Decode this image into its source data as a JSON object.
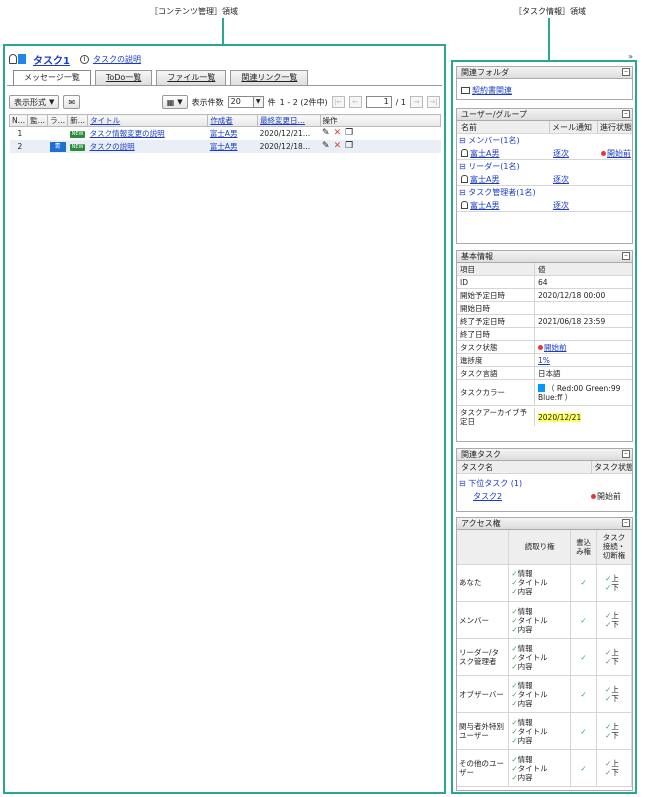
{
  "callouts": {
    "left": "［コンテンツ管理］領域",
    "right": "［タスク情報］領域"
  },
  "task": {
    "title": "タスク1",
    "link": "タスクの説明",
    "accent_color": "#1e88e5"
  },
  "tabs": [
    "メッセージ一覧",
    "ToDo一覧",
    "ファイル一覧",
    "関連リンク一覧"
  ],
  "toolbar": {
    "format_button": "表示形式",
    "count_label": "表示件数",
    "count_value": "20",
    "count_suffix": "件",
    "range": "1 - 2 (2件中)",
    "page_value": "1",
    "page_total": "/ 1"
  },
  "table": {
    "columns": [
      "N…",
      "監…",
      "ラ…",
      "新…",
      "タイトル",
      "作成者",
      "最終変更日…",
      "操作"
    ],
    "rows": [
      {
        "no": "1",
        "label": "",
        "new": "NEW",
        "title": "タスク情報変更の説明",
        "author": "富士A男",
        "modified": "2020/12/21…"
      },
      {
        "no": "2",
        "label": "青",
        "new": "NEW",
        "title": "タスクの説明",
        "author": "富士A男",
        "modified": "2020/12/18…"
      }
    ]
  },
  "right": {
    "collapse": "»",
    "related_folder": {
      "title": "関連フォルダ",
      "item": "契約書関連"
    },
    "users": {
      "title": "ユーザー/グループ",
      "headers": [
        "名前",
        "メール通知",
        "進行状態"
      ],
      "members_group": "メンバー(1名)",
      "members": [
        {
          "name": "富士A男",
          "mail": "逐次",
          "state": "開始前"
        }
      ],
      "leaders_group": "リーダー(1名)",
      "leaders": [
        {
          "name": "富士A男",
          "mail": "逐次"
        }
      ],
      "managers_group": "タスク管理者(1名)",
      "managers": [
        {
          "name": "富士A男",
          "mail": "逐次"
        }
      ]
    },
    "basic": {
      "title": "基本情報",
      "headers": [
        "項目",
        "値"
      ],
      "items": [
        {
          "k": "ID",
          "v": "64"
        },
        {
          "k": "開始予定日時",
          "v": "2020/12/18 00:00"
        },
        {
          "k": "開始日時",
          "v": ""
        },
        {
          "k": "終了予定日時",
          "v": "2021/06/18 23:59"
        },
        {
          "k": "終了日時",
          "v": ""
        },
        {
          "k": "タスク状態",
          "v": "開始前"
        },
        {
          "k": "進捗度",
          "v": "1%"
        },
        {
          "k": "タスク言語",
          "v": "日本語"
        },
        {
          "k": "タスクカラー",
          "v": "（ Red:00  Green:99  Blue:ff ）"
        },
        {
          "k": "タスクアーカイブ予定日",
          "v": "2020/12/21"
        }
      ]
    },
    "related_task": {
      "title": "関連タスク",
      "headers": [
        "タスク名",
        "タスク状態"
      ],
      "group": "下位タスク (1)",
      "item": {
        "name": "タスク2",
        "state": "開始前"
      }
    },
    "access": {
      "title": "アクセス権",
      "headers": [
        "",
        "読取り権",
        "書込み権",
        "タスク接続・切断権"
      ],
      "read_items": [
        "情報",
        "タイトル",
        "内容"
      ],
      "conn_items": [
        "上",
        "下"
      ],
      "rows": [
        "あなた",
        "メンバー",
        "リーダー/タスク管理者",
        "オブザーバー",
        "関与者外特別ユーザー",
        "その他のユーザー"
      ]
    }
  }
}
